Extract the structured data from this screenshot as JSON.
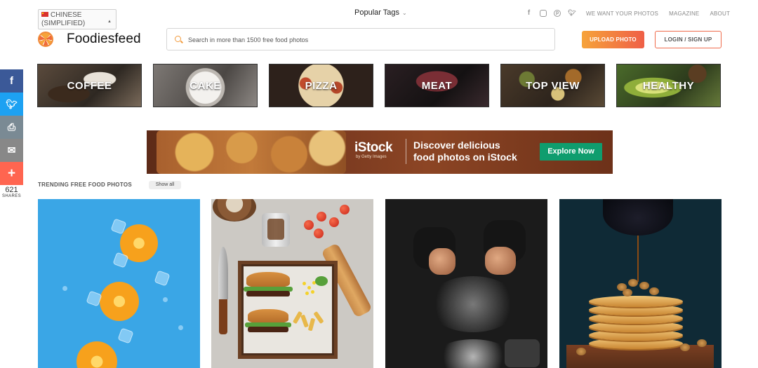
{
  "language": {
    "selected": "CHINESE (SIMPLIFIED)",
    "line1": "CHINESE",
    "line2": "(SIMPLIFIED)"
  },
  "brand": {
    "name": "Foodiesfeed"
  },
  "popular_tags": {
    "label": "Popular Tags"
  },
  "search": {
    "placeholder": "Search in more than 1500 free food photos",
    "icon": "search-icon"
  },
  "social_top": [
    "facebook-icon",
    "instagram-icon",
    "pinterest-icon",
    "twitter-icon"
  ],
  "top_nav": [
    "WE WANT YOUR PHOTOS",
    "MAGAZINE",
    "ABOUT"
  ],
  "buttons": {
    "upload": "UPLOAD PHOTO",
    "login": "LOGIN / SIGN UP"
  },
  "share_bar": {
    "items": [
      {
        "icon": "facebook-icon",
        "glyph": "f",
        "color": "#3b5998"
      },
      {
        "icon": "twitter-icon",
        "glyph": "t",
        "color": "#1da1f2"
      },
      {
        "icon": "print-icon",
        "glyph": "⎙",
        "color": "#7a8a94"
      },
      {
        "icon": "email-icon",
        "glyph": "✉",
        "color": "#888888"
      },
      {
        "icon": "plus-icon",
        "glyph": "+",
        "color": "#ff6550"
      }
    ],
    "count": "621",
    "count_label": "SHARES"
  },
  "categories": [
    "COFFEE",
    "CAKE",
    "PIZZA",
    "MEAT",
    "TOP VIEW",
    "HEALTHY"
  ],
  "banner": {
    "brand": "iStock",
    "sub": "by Getty Images",
    "headline_1": "Discover delicious",
    "headline_2": "food photos on iStock",
    "cta": "Explore Now",
    "cta_color": "#0f9d6e"
  },
  "trending": {
    "title": "TRENDING FREE FOOD PHOTOS",
    "show_all": "Show all"
  },
  "colors": {
    "accent_orange": "#f6a33a",
    "accent_red": "#ef5f47"
  }
}
